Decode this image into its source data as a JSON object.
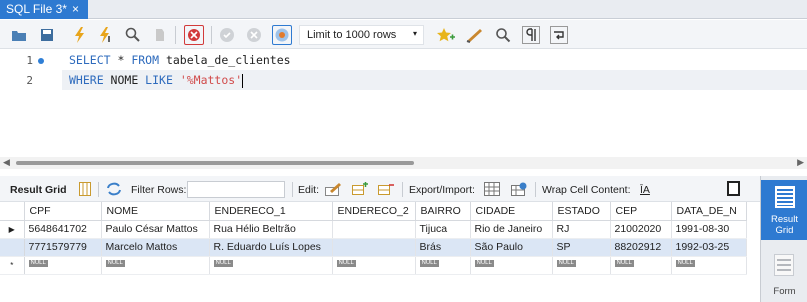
{
  "tab": {
    "title": "SQL File 3*",
    "close": "×"
  },
  "toolbar": {
    "icons": [
      "folder-open-icon",
      "save-icon",
      "execute-icon",
      "execute-cursor-icon",
      "explain-icon",
      "stop-icon",
      "toggle-continue-icon",
      "commit-icon",
      "rollback-icon",
      "autocommit-icon",
      "favorite-add-icon",
      "beautify-icon",
      "find-icon",
      "invisible-chars-icon",
      "wrap-icon"
    ],
    "limit_label": "Limit to 1000 rows",
    "limit_arrow": "▾"
  },
  "editor": {
    "line_numbers": [
      "1",
      "2"
    ],
    "line1": {
      "kw1": "SELECT",
      "rest1": " * ",
      "kw2": "FROM",
      "rest2": " tabela_de_clientes"
    },
    "line2": {
      "kw1": "WHERE",
      "rest1": " NOME ",
      "kw2": "LIKE",
      "space": " ",
      "str": "'%Mattos'"
    }
  },
  "result_toolbar": {
    "result_grid": "Result Grid",
    "filter_rows": "Filter Rows:",
    "edit": "Edit:",
    "export_import": "Export/Import:",
    "wrap_cell": "Wrap Cell Content:",
    "wrap_glyph": "ĪA"
  },
  "grid": {
    "columns": [
      "CPF",
      "NOME",
      "ENDERECO_1",
      "ENDERECO_2",
      "BAIRRO",
      "CIDADE",
      "ESTADO",
      "CEP",
      "DATA_DE_N"
    ],
    "rows": [
      {
        "marker": "▶",
        "cells": [
          "5648641702",
          "Paulo César Mattos",
          "Rua Hélio Beltrão",
          "",
          "Tijuca",
          "Rio de Janeiro",
          "RJ",
          "21002020",
          "1991-08-30"
        ]
      },
      {
        "marker": "",
        "cells": [
          "7771579779",
          "Marcelo Mattos",
          "R. Eduardo Luís Lopes",
          "",
          "Brás",
          "São Paulo",
          "SP",
          "88202912",
          "1992-03-25"
        ]
      }
    ],
    "new_row_marker": "*",
    "null_label": "NULL"
  },
  "side_panel": {
    "result_grid_label_1": "Result",
    "result_grid_label_2": "Grid",
    "form_label": "Form"
  },
  "colors": {
    "accent": "#2e7ad1",
    "keyword": "#2e6bbd",
    "string": "#d14b4b",
    "selected_row": "#dbe6f5"
  }
}
